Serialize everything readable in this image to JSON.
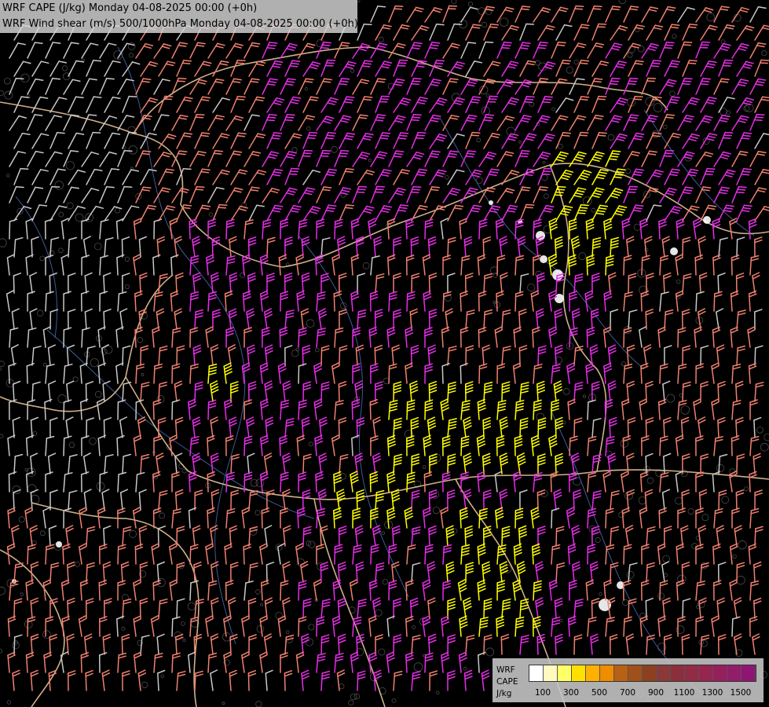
{
  "header": {
    "line1": "WRF CAPE (J/kg) Monday 04-08-2025 00:00 (+0h)",
    "line2": "WRF Wind shear (m/s) 500/1000hPa Monday 04-08-2025 00:00 (+0h)"
  },
  "legend": {
    "label_line1": "WRF",
    "label_line2": "CAPE",
    "label_line3": "J/kg",
    "ticks": [
      "100",
      "300",
      "500",
      "700",
      "900",
      "1100",
      "1300",
      "1500"
    ],
    "colors": [
      "#ffffff",
      "#fffac0",
      "#ffff66",
      "#ffe000",
      "#ffb000",
      "#f08c00",
      "#b86014",
      "#a0501a",
      "#8c4020",
      "#8a3838",
      "#8c2f3c",
      "#922c44",
      "#962650",
      "#96205e",
      "#941c6a",
      "#901474"
    ]
  },
  "map_colors": {
    "background": "#000000",
    "border": "#e7c49a",
    "river": "#3c5a96",
    "terrain": "#6a6a6a",
    "barb_low": "#c8c8c8",
    "barb_mid": "#f08070",
    "barb_high": "#e62ee6",
    "barb_max": "#ffff00"
  }
}
